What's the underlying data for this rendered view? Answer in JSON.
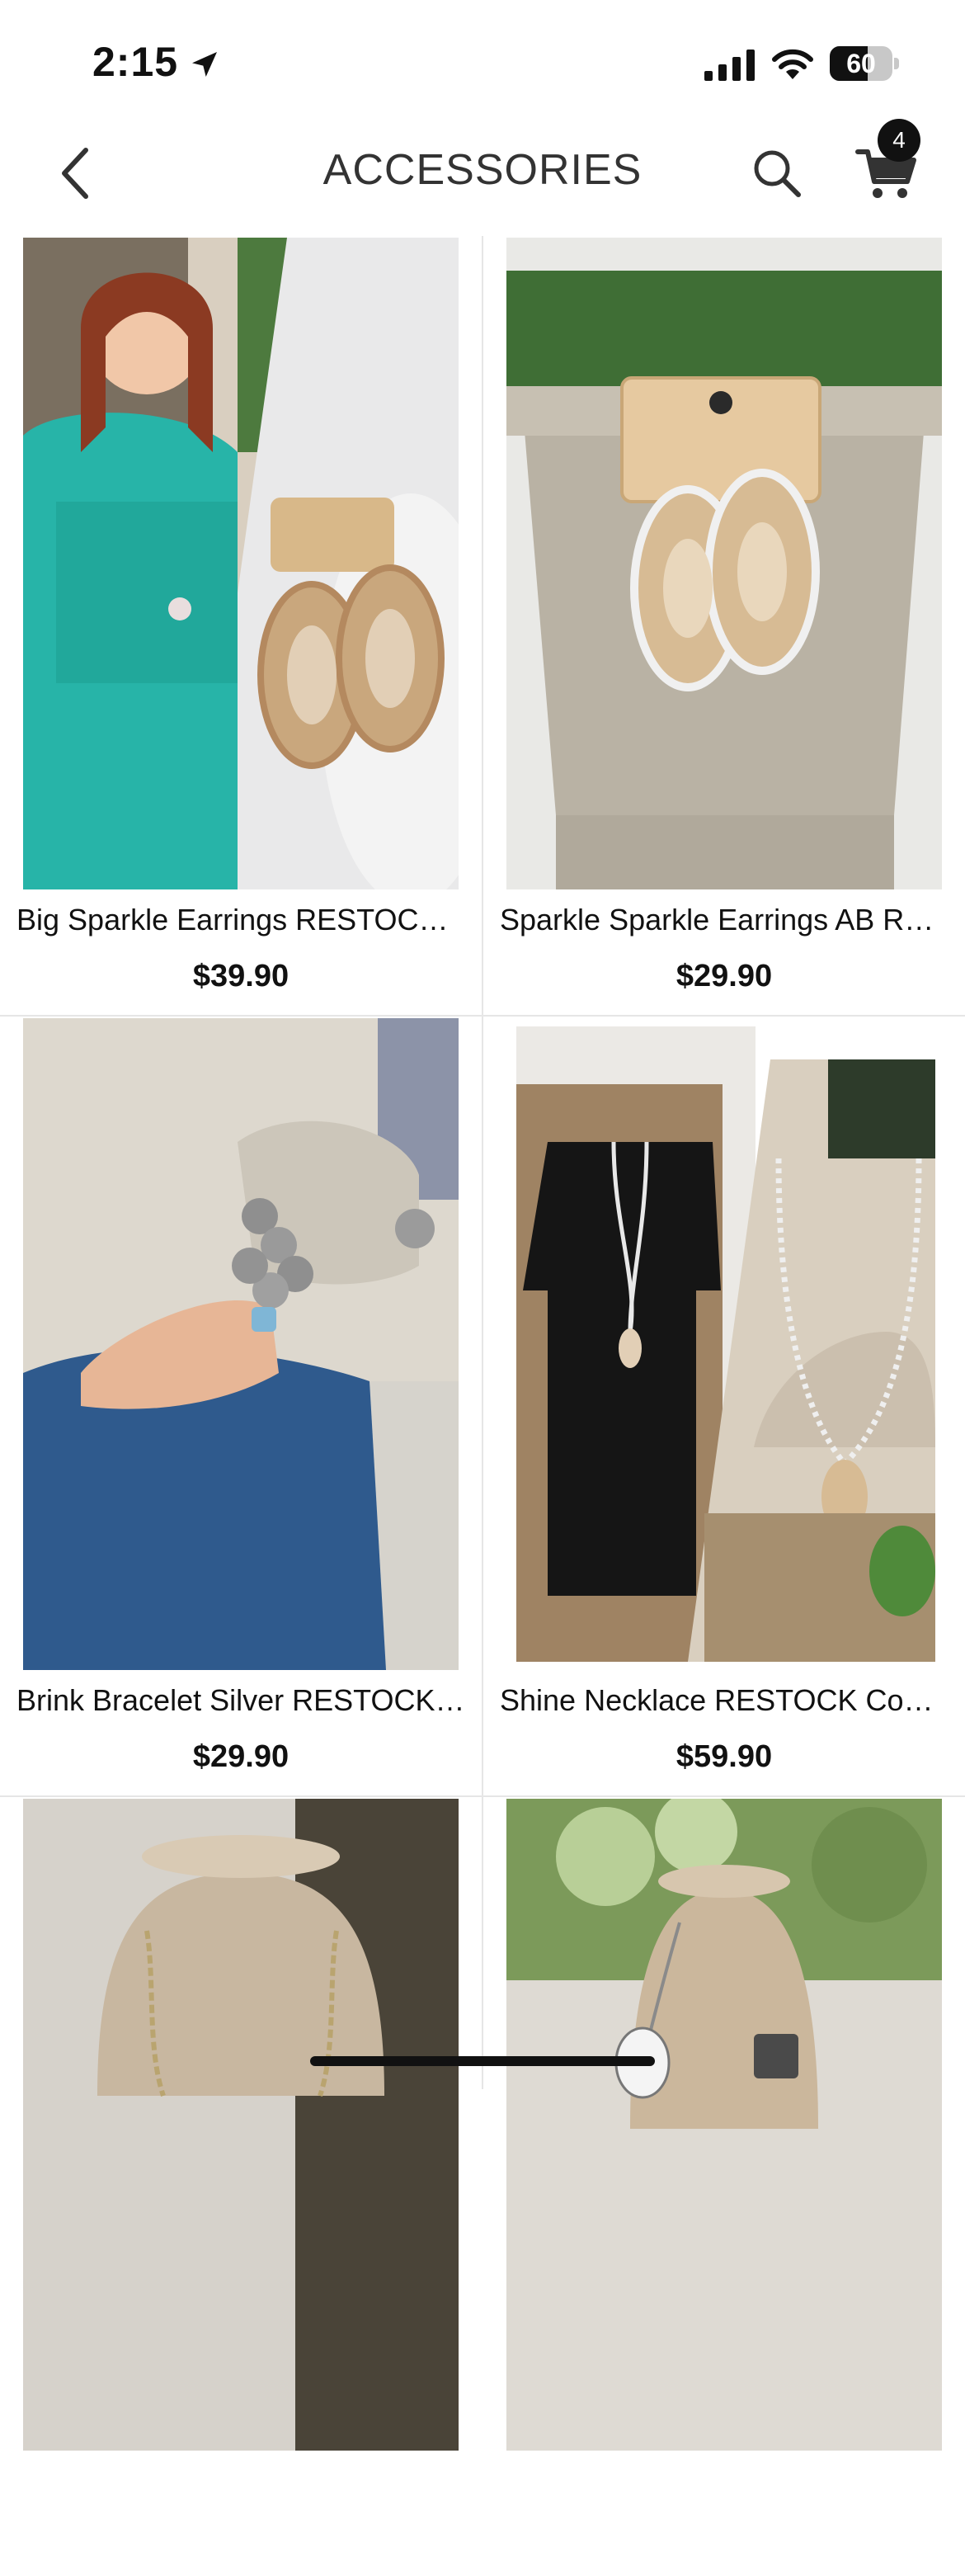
{
  "status_bar": {
    "time": "2:15",
    "battery": "60",
    "battery_level": 0.6
  },
  "nav": {
    "title": "ACCESSORIES",
    "cart_count": "4"
  },
  "products": [
    {
      "name": "Big Sparkle Earrings RESTOCK…",
      "price": "$39.90"
    },
    {
      "name": "Sparkle Sparkle Earrings AB RE…",
      "price": "$29.90"
    },
    {
      "name": "Brink Bracelet Silver RESTOCK…",
      "price": "$29.90"
    },
    {
      "name": "Shine Necklace RESTOCK Com…",
      "price": "$59.90"
    }
  ],
  "colors": {
    "accent": "#111111",
    "divider": "#e6e6e6"
  }
}
